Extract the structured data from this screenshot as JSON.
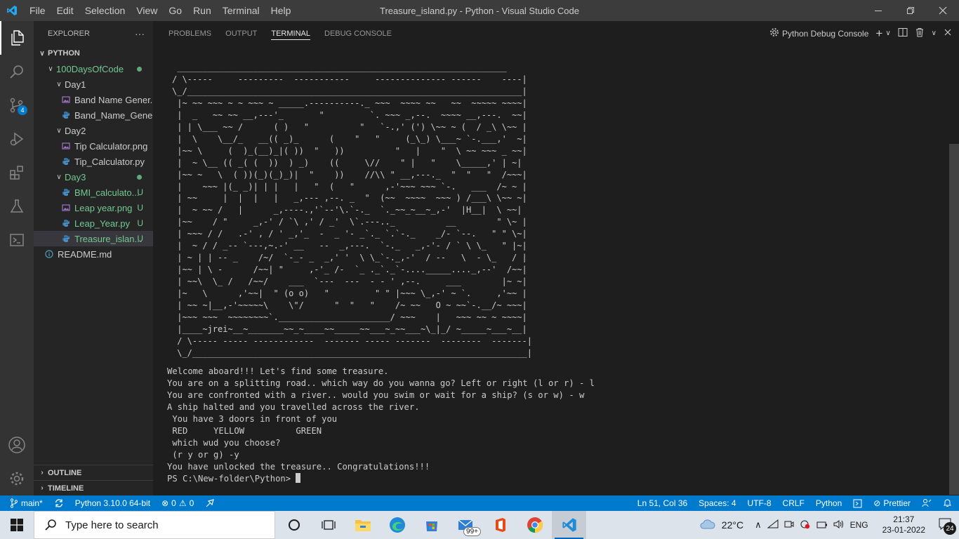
{
  "window": {
    "title": "Treasure_island.py - Python - Visual Studio Code",
    "menu": [
      "File",
      "Edit",
      "Selection",
      "View",
      "Go",
      "Run",
      "Terminal",
      "Help"
    ]
  },
  "activity_bar": {
    "items": [
      "explorer-icon",
      "search-icon",
      "source-control-icon",
      "run-debug-icon",
      "extensions-icon",
      "testing-icon",
      "remote-explorer-icon"
    ],
    "source_control_badge": "4",
    "bottom": [
      "account-icon",
      "settings-gear-icon"
    ]
  },
  "sidebar": {
    "header": "EXPLORER",
    "more": "···",
    "root": "PYTHON",
    "tree": [
      {
        "label": "100DaysOfCode",
        "type": "folder",
        "status": "dot"
      },
      {
        "label": "Day1",
        "type": "folder"
      },
      {
        "label": "Band Name Gener...",
        "type": "png"
      },
      {
        "label": "Band_Name_Gener...",
        "type": "py"
      },
      {
        "label": "Day2",
        "type": "folder"
      },
      {
        "label": "Tip Calculator.png",
        "type": "png"
      },
      {
        "label": "Tip_Calculator.py",
        "type": "py"
      },
      {
        "label": "Day3",
        "type": "folder",
        "status": "dot"
      },
      {
        "label": "BMI_calculato...",
        "type": "py",
        "status": "U"
      },
      {
        "label": "Leap year.png",
        "type": "png",
        "status": "U"
      },
      {
        "label": "Leap_Year.py",
        "type": "py",
        "status": "U"
      },
      {
        "label": "Treasure_islan...",
        "type": "py",
        "status": "U"
      },
      {
        "label": "README.md",
        "type": "info"
      }
    ],
    "outline": "OUTLINE",
    "timeline": "TIMELINE"
  },
  "panel": {
    "tabs": [
      "PROBLEMS",
      "OUTPUT",
      "TERMINAL",
      "DEBUG CONSOLE"
    ],
    "active_tab": "TERMINAL",
    "terminal_selector": "Python Debug Console"
  },
  "terminal": {
    "art": " _________________________________________________________________\n/ \\-----     ---------  -----------     -------------- ------    ----|\n\\_/__________________________________________________________________|\n |~ ~~ ~~~ ~ ~ ~~~ ~ _____.----------._ ~~~  ~~~~ ~~   ~~  ~~~~~ ~~~~|\n |  _   ~~ ~~ __,---'_       \"         `. ~~~ _,--.  ~~~~ __,---.  ~~|\n | | \\___ ~~ /      ( )   \"          \"   `-.,' (') \\~~ ~ (  / _\\ \\~~ |\n |  \\    \\__/_   __(( _)_      (    \"   \"     (_\\_) \\___~ `-.___,'  ~|\n |~~ \\     (  )_(__)_|( ))  \"   ))          \"   |    \"  \\ ~~ ~~~ _ ~~|\n |  ~ \\__ (( _( (  ))  ) _)    ((     \\//    \" |   \"    \\_____,' | ~|\n |~~ ~   \\  ( ))(_)(_)_)|  \"    ))    //\\\\ \" __,---._  \"  \"   \"  /~~~|\n |    ~~~ |(_ _)| | |   |   \"  (   \"      ,-'~~~ ~~~ `-.   ___  /~ ~ |\n | ~~     |  |  |   |   _,--- ,--. _  \"  (~~  ~~~~  ~~~ ) /___\\ \\~~ ~|\n |  ~ ~~ /   |      _,----.,'`--'\\.`-._  `._~~_~__~_,-'  |H__|  \\ ~~|\n |~~    / \"     _,-' / `\\ ,' / _'  \\`.---.._          __        \" \\~ |\n | ~~~ / /   .-' , / ' _,'_  -  _ '- _`._ `.`-._    _/- `--.   \" \" \\~|\n |  ~ / / _-- `---,~.-' __   --  _,---.  `-._   _,-'- / ` \\ \\_   \" |~|\n | ~ | | -- _    /~/  `-_- _  _,' '  \\ \\_`-._,-'  / --   \\  - \\_   / |\n |~~ | \\ -      /~~| \"     ,-'_ /-  `_ ._`._`-...._____...._,--'  /~~|\n | ~~\\  \\_ /   /~~/    ___  `---  ---  - - ' ,--.     ___        |~ ~|\n |~   \\      ,'~~|  \" (o o)   \"         \" \" |~~~ \\_,-' ~ `.     ,'~~ |\n | ~~ ~|__,-'~~~~~\\    \\\"/      \"  \"   \"    /~ ~~   O ~ ~~`-.__/~ ~~~|\n |~~~ ~~~  ~~~~~~~~`.______________________/ ~~~    |   ~~~ ~~ ~ ~~~~|\n |____~jrei~__~_______~~_~____~~_____~~___~_~~___~\\_|_/ ~_____~___~__|\n / \\----- ----- ------------  ------- ----- -------  --------  -------|\n \\_/__________________________________________________________________|",
    "lines": [
      "Welcome aboard!!! Let's find some treasure.",
      "You are on a splitting road.. which way do you wanna go? Left or right (l or r) - l",
      "You are confronted with a river.. would you swim or wait for a ship? (s or w) - w",
      "A ship halted and you travelled across the river.",
      " You have 3 doors in front of you",
      " RED     YELLOW          GREEN",
      " which wud you choose?",
      " (r y or g) -y",
      "You have unlocked the treasure.. Congratulations!!!"
    ],
    "prompt": "PS C:\\New-folder\\Python> "
  },
  "statusbar": {
    "branch": "main*",
    "interpreter": "Python 3.10.0 64-bit",
    "errors": "0",
    "warnings": "0",
    "position": "Ln 51, Col 36",
    "spaces": "Spaces: 4",
    "encoding": "UTF-8",
    "eol": "CRLF",
    "language": "Python",
    "prettier": "Prettier"
  },
  "taskbar": {
    "search_placeholder": "Type here to search",
    "mail_badge": "99+",
    "temperature": "22°C",
    "language": "ENG",
    "time": "21:37",
    "date": "23-01-2022",
    "notification_count": "24"
  },
  "colors": {
    "accent": "#007acc",
    "activity_bar": "#333333",
    "sidebar": "#252526",
    "panel": "#1e1e1e",
    "git_untracked": "#73c991"
  }
}
